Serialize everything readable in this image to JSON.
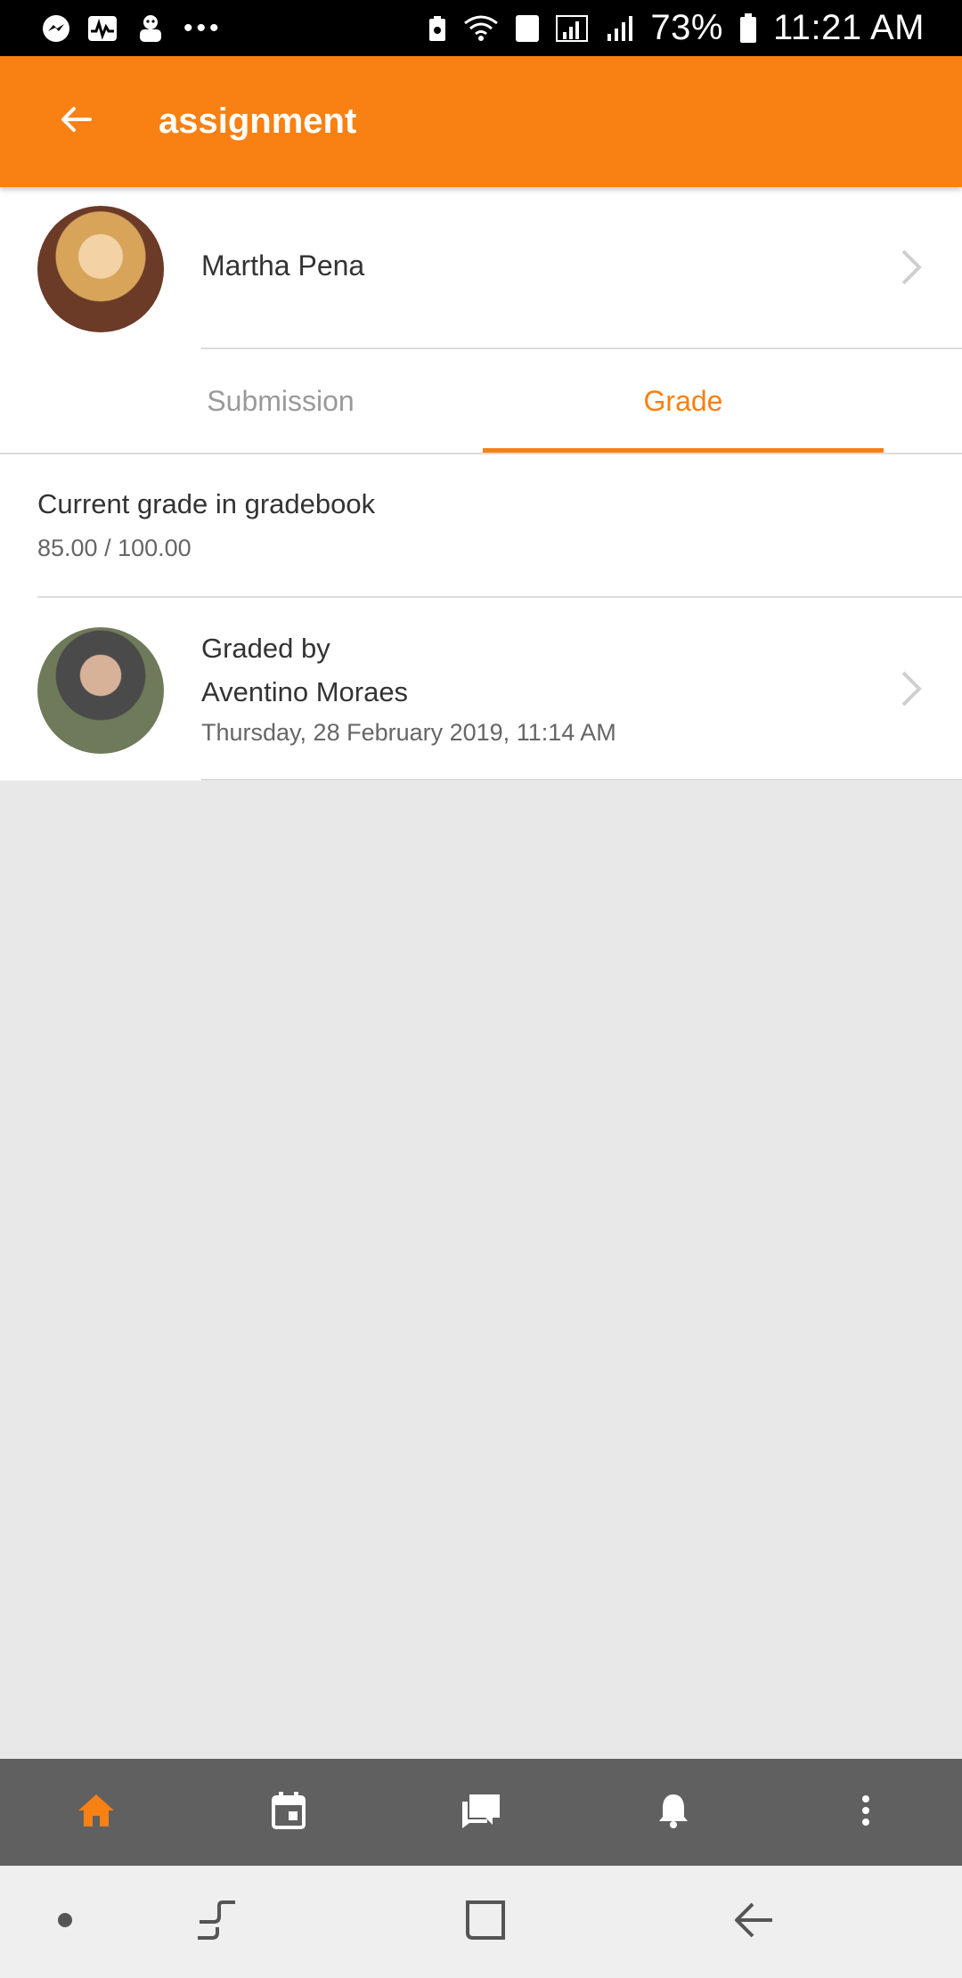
{
  "status_bar": {
    "battery": "73%",
    "time": "11:21 AM",
    "sim_label": "1",
    "left_icons": [
      "messenger-icon",
      "activity-icon",
      "mascot-icon"
    ],
    "right_icons": [
      "recycle-icon",
      "wifi-icon",
      "sim-icon",
      "signal-icon",
      "signal-icon",
      "battery-icon"
    ]
  },
  "app_bar": {
    "title": "assignment"
  },
  "student": {
    "name": "Martha Pena"
  },
  "tabs": [
    {
      "label": "Submission",
      "active": false
    },
    {
      "label": "Grade",
      "active": true
    }
  ],
  "grade": {
    "label": "Current grade in gradebook",
    "value": "85.00 / 100.00"
  },
  "graded_by": {
    "label": "Graded by",
    "name": "Aventino Moraes",
    "date": "Thursday, 28 February 2019, 11:14 AM"
  },
  "bottom_nav": {
    "items": [
      "home-icon",
      "calendar-icon",
      "messages-icon",
      "notifications-icon",
      "more-icon"
    ],
    "active": "home-icon"
  },
  "colors": {
    "accent": "#f98012",
    "bottom_nav_bg": "#606060",
    "content_bg": "#e8e8e8"
  }
}
